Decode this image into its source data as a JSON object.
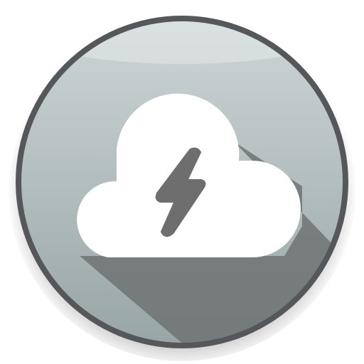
{
  "icon": {
    "name": "thunderstorm-cloud-app-icon",
    "glyph": "cloud-with-lightning-bolt",
    "colors": {
      "rim": "#56575b",
      "face_top": "#cdd5d5",
      "face_bottom": "#99a6a6",
      "highlight": "#e4eaea",
      "long_shadow": "#6f7373",
      "cloud": "#ffffff",
      "bolt": "#6e6e6e"
    }
  }
}
